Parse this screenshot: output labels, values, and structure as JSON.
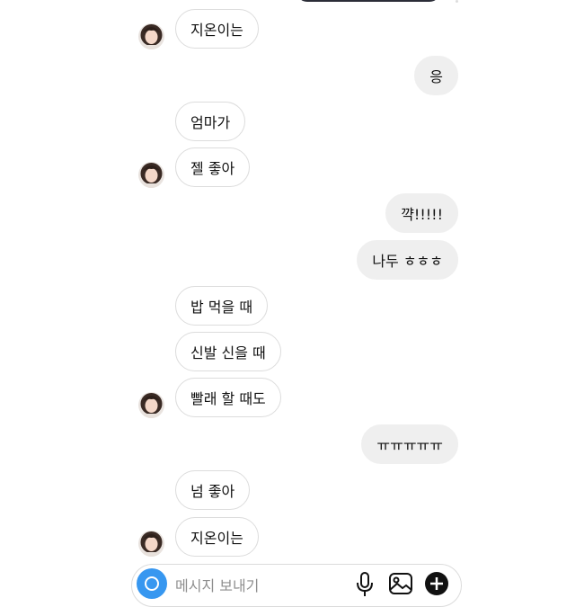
{
  "messages": [
    {
      "side": "recv",
      "text": "지온이는"
    },
    {
      "side": "sent",
      "text": "응"
    },
    {
      "side": "recv",
      "text": "엄마가"
    },
    {
      "side": "recv",
      "text": "젤 좋아"
    },
    {
      "side": "sent",
      "text": "꺅!!!!!"
    },
    {
      "side": "sent",
      "text": "나두 ㅎㅎㅎ"
    },
    {
      "side": "recv",
      "text": "밥 먹을 때"
    },
    {
      "side": "recv",
      "text": "신발 신을 때"
    },
    {
      "side": "recv",
      "text": "빨래 할 때도"
    },
    {
      "side": "sent",
      "text": "ㅠㅠㅠㅠㅠ"
    },
    {
      "side": "recv",
      "text": "넘 좋아"
    },
    {
      "side": "recv",
      "text": "지온이는"
    }
  ],
  "composer": {
    "placeholder": "메시지 보내기",
    "icons": [
      "camera-icon",
      "microphone-icon",
      "image-icon",
      "plus-icon"
    ]
  },
  "colors": {
    "sent_bubble": "#efefef",
    "received_border": "#dcdcdc",
    "camera_blue": "#3797f0"
  }
}
